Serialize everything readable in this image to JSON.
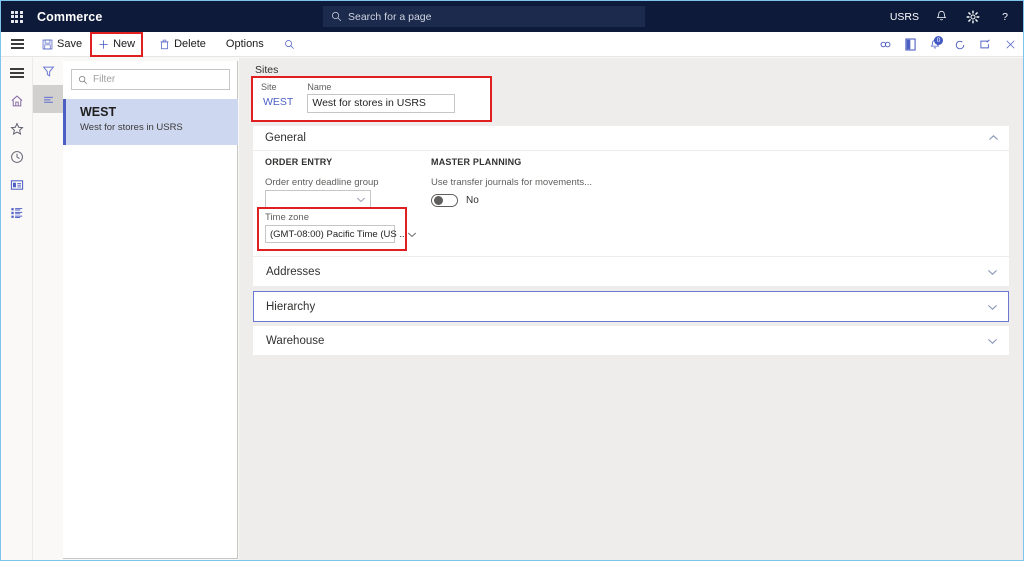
{
  "topnav": {
    "waffle_icon": "app-launcher-icon",
    "brand": "Commerce",
    "search": {
      "icon": "search-icon",
      "placeholder": "Search for a page"
    },
    "company": "USRS",
    "notification_icon": "bell-icon",
    "settings_icon": "gear-icon",
    "help_icon": "help-icon",
    "help_glyph": "?"
  },
  "commandbar": {
    "menu_icon": "hamburger-menu-icon",
    "save_label": "Save",
    "save_icon": "save-icon",
    "new_label": "New",
    "new_icon": "plus-icon",
    "delete_label": "Delete",
    "delete_icon": "trash-icon",
    "options_label": "Options",
    "search_icon": "search-icon",
    "right_icons": [
      {
        "name": "attachments-icon"
      },
      {
        "name": "office-icon"
      },
      {
        "name": "notifications-icon",
        "badge": "0"
      },
      {
        "name": "refresh-icon"
      },
      {
        "name": "popout-icon"
      },
      {
        "name": "close-icon",
        "glyph": "✕"
      }
    ],
    "highlight_color": "#e02020"
  },
  "rail": {
    "items": [
      {
        "name": "hamburger-menu-icon",
        "label": "Expand the navigation pane"
      },
      {
        "name": "home-icon",
        "label": "Home"
      },
      {
        "name": "star-icon",
        "label": "Favorites"
      },
      {
        "name": "clock-icon",
        "label": "Recent"
      },
      {
        "name": "workspaces-icon",
        "label": "Workspaces"
      },
      {
        "name": "modules-icon",
        "label": "Modules"
      }
    ]
  },
  "rail2": {
    "items": [
      {
        "name": "filter-icon",
        "label": "Filter",
        "active": false
      },
      {
        "name": "list-icon",
        "label": "List",
        "active": true
      }
    ]
  },
  "listpane": {
    "filter": {
      "icon": "search-icon",
      "placeholder": "Filter",
      "value": ""
    },
    "items": [
      {
        "title": "WEST",
        "subtitle": "West for stores in USRS",
        "selected": true
      }
    ]
  },
  "content": {
    "caption": "Sites",
    "header_card": {
      "site_label": "Site",
      "site_value": "WEST",
      "name_label": "Name",
      "name_value": "West for stores in USRS",
      "highlighted": true
    },
    "sections": [
      {
        "title": "General",
        "expanded": true,
        "chevron": "chevron-up-icon",
        "groups": [
          {
            "heading": "ORDER ENTRY",
            "fields": [
              {
                "label": "Order entry deadline group",
                "value": "",
                "type": "select"
              },
              {
                "label": "Time zone",
                "value": "(GMT-08:00) Pacific Time (US ...",
                "type": "select",
                "highlighted": true
              }
            ]
          },
          {
            "heading": "MASTER PLANNING",
            "fields": [
              {
                "label": "Use transfer journals for movements...",
                "value": "No",
                "type": "toggle",
                "on": false
              }
            ]
          }
        ]
      },
      {
        "title": "Addresses",
        "expanded": false,
        "chevron": "chevron-down-icon",
        "focused": false
      },
      {
        "title": "Hierarchy",
        "expanded": false,
        "chevron": "chevron-down-icon",
        "focused": true
      },
      {
        "title": "Warehouse",
        "expanded": false,
        "chevron": "chevron-down-icon",
        "focused": false
      }
    ]
  },
  "colors": {
    "brand_navy": "#0d1a3a",
    "accent_blue": "#4e5fc4",
    "highlight_red": "#e02020",
    "selection_blue": "#cdd7ef"
  }
}
